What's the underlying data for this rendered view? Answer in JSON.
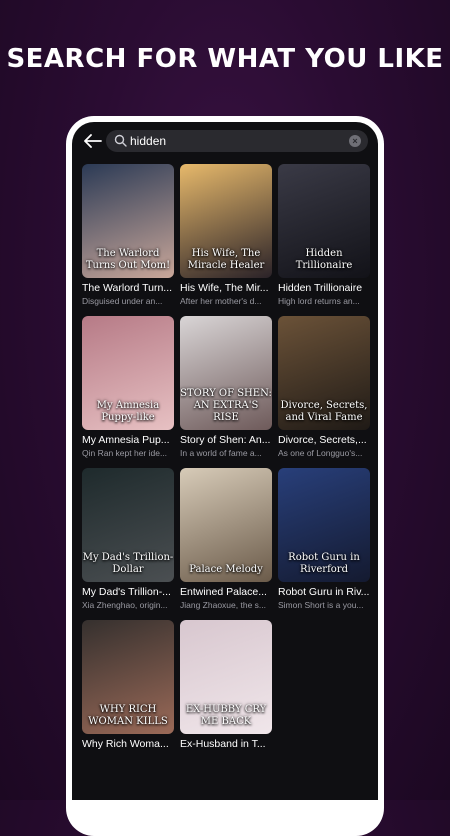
{
  "headline": "SEARCH FOR WHAT YOU LIKE",
  "search": {
    "value": "hidden"
  },
  "results": [
    {
      "title": "The Warlord Turn...",
      "desc": "Disguised under an...",
      "poster_text": "The Warlord Turns Out Mom!",
      "colors": [
        "#2b3a55",
        "#c9a79a"
      ]
    },
    {
      "title": "His Wife, The Mir...",
      "desc": "After her mother's d...",
      "poster_text": "His Wife, The Miracle Healer",
      "colors": [
        "#e7b96b",
        "#2a2228"
      ]
    },
    {
      "title": "Hidden Trillionaire",
      "desc": "High lord returns an...",
      "poster_text": "Hidden Trillionaire",
      "colors": [
        "#3a3a46",
        "#121218"
      ]
    },
    {
      "title": "My Amnesia Pup...",
      "desc": "Qin Ran kept her ide...",
      "poster_text": "My Amnesia Puppy-like",
      "colors": [
        "#b67a86",
        "#e7c1c3"
      ]
    },
    {
      "title": "Story of Shen: An...",
      "desc": "In a world of fame a...",
      "poster_text": "STORY OF SHEN: AN EXTRA'S RISE",
      "colors": [
        "#d9d5d6",
        "#6e5a5a"
      ]
    },
    {
      "title": "Divorce, Secrets,...",
      "desc": "As one of Longguo's...",
      "poster_text": "Divorce, Secrets, and Viral Fame",
      "colors": [
        "#6b5238",
        "#1f1a16"
      ]
    },
    {
      "title": "My Dad's Trillion-...",
      "desc": "Xia Zhenghao, origin...",
      "poster_text": "My Dad's Trillion-Dollar",
      "colors": [
        "#1e2a2c",
        "#4b4f52"
      ]
    },
    {
      "title": "Entwined Palace...",
      "desc": "Jiang Zhaoxue, the s...",
      "poster_text": "Palace Melody",
      "colors": [
        "#d7cbb8",
        "#6b5b4a"
      ]
    },
    {
      "title": "Robot Guru in Riv...",
      "desc": "Simon Short is a you...",
      "poster_text": "Robot Guru in Riverford",
      "colors": [
        "#283f7a",
        "#141a30"
      ]
    },
    {
      "title": "Why Rich Woma...",
      "desc": "",
      "poster_text": "WHY RICH WOMAN KILLS",
      "colors": [
        "#35302e",
        "#9b6a58"
      ]
    },
    {
      "title": "Ex-Husband in T...",
      "desc": "",
      "poster_text": "EX-HUBBY CRY ME BACK",
      "colors": [
        "#d8c7cf",
        "#f0e6ea"
      ]
    }
  ]
}
